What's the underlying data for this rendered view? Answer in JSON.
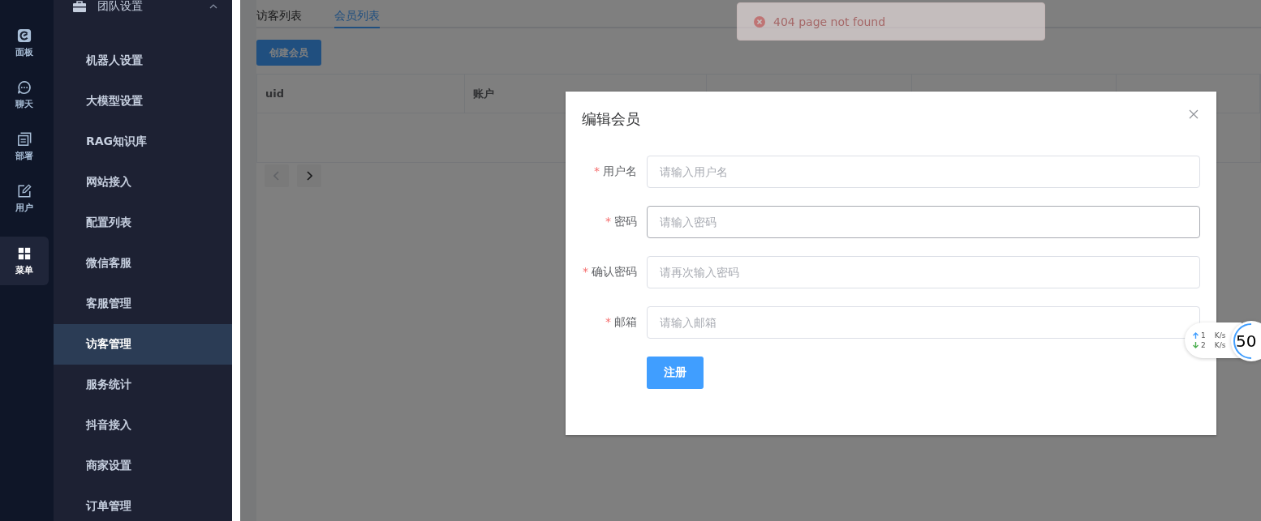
{
  "rail": [
    {
      "kind": "dashboard",
      "label": "面板",
      "selected": false
    },
    {
      "kind": "chat",
      "label": "聊天",
      "selected": false
    },
    {
      "kind": "deploy",
      "label": "部署",
      "selected": false
    },
    {
      "kind": "user",
      "label": "用户",
      "selected": false
    },
    {
      "kind": "menu",
      "label": "菜单",
      "selected": true
    }
  ],
  "sidebar": {
    "group": {
      "label": "团队设置",
      "expanded": true
    },
    "items": [
      {
        "label": "机器人设置",
        "selected": false
      },
      {
        "label": "大模型设置",
        "selected": false
      },
      {
        "label": "RAG知识库",
        "selected": false
      },
      {
        "label": "网站接入",
        "selected": false
      },
      {
        "label": "配置列表",
        "selected": false
      },
      {
        "label": "微信客服",
        "selected": false
      },
      {
        "label": "客服管理",
        "selected": false
      },
      {
        "label": "访客管理",
        "selected": true
      },
      {
        "label": "服务统计",
        "selected": false
      },
      {
        "label": "抖音接入",
        "selected": false
      },
      {
        "label": "商家设置",
        "selected": false
      },
      {
        "label": "订单管理",
        "selected": false
      }
    ]
  },
  "tabs": [
    {
      "label": "访客列表",
      "selected": false
    },
    {
      "label": "会员列表",
      "selected": true
    }
  ],
  "create_button": "创建会员",
  "table": {
    "columns": [
      "uid",
      "账户"
    ]
  },
  "pagination": [
    {
      "kind": "prev",
      "disabled": true
    },
    {
      "kind": "next",
      "disabled": false
    }
  ],
  "toast": {
    "kind": "error",
    "message": "404 page not found"
  },
  "dialog": {
    "title": "编辑会员",
    "fields": [
      {
        "label": "用户名",
        "required_mark": "*",
        "placeholder": "请输入用户名",
        "hovered": false
      },
      {
        "label": "密码",
        "required_mark": "*",
        "placeholder": "请输入密码",
        "hovered": true
      },
      {
        "label": "确认密码",
        "required_mark": "*",
        "placeholder": "请再次输入密码",
        "hovered": false
      },
      {
        "label": "邮箱",
        "required_mark": "*",
        "placeholder": "请输入邮箱",
        "hovered": false
      }
    ],
    "submit": "注册"
  },
  "net_widget": {
    "up": "1",
    "up_unit": "K/s",
    "down": "2",
    "down_unit": "K/s",
    "percent": "50"
  }
}
